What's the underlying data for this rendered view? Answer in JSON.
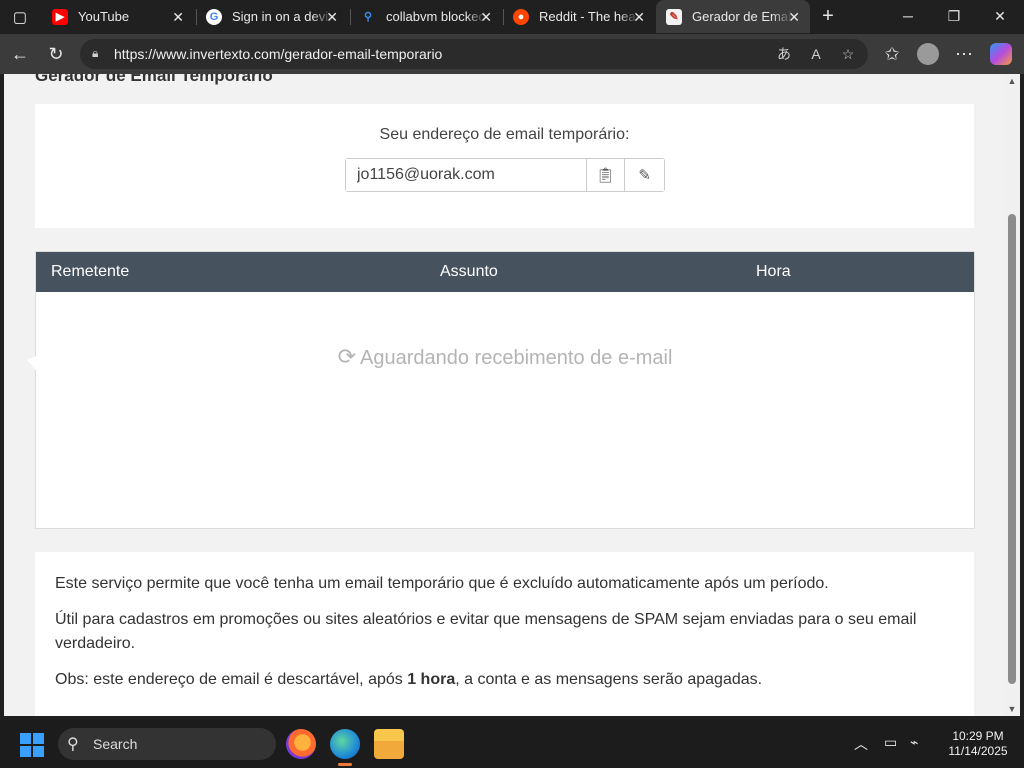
{
  "browser": {
    "tabs": [
      {
        "title": "YouTube",
        "icon": "youtube-icon",
        "color": "#ff0000"
      },
      {
        "title": "Sign in on a device",
        "icon": "google-icon",
        "color": "#4285f4"
      },
      {
        "title": "collabvm blocked",
        "icon": "bing-search-icon",
        "color": "#3b8eea"
      },
      {
        "title": "Reddit - The heart",
        "icon": "reddit-icon",
        "color": "#ff4500"
      },
      {
        "title": "Gerador de Email",
        "icon": "invertexto-icon",
        "color": "#f2f2f2"
      }
    ],
    "url": "https://www.invertexto.com/gerador-email-temporario"
  },
  "page": {
    "title": "Gerador de Email Temporário",
    "email_label": "Seu endereço de email temporário:",
    "email_value": "jo1156@uorak.com",
    "inbox": {
      "columns": [
        "Remetente",
        "Assunto",
        "Hora"
      ],
      "waiting_text": "Aguardando recebimento de e-mail"
    },
    "info": {
      "p1": "Este serviço permite que você tenha um email temporário que é excluído automaticamente após um período.",
      "p2": "Útil para cadastros em promoções ou sites aleatórios e evitar que mensagens de SPAM sejam enviadas para o seu email verdadeiro.",
      "p3_prefix": "Obs: este endereço de email é descartável, após ",
      "p3_bold": "1 hora",
      "p3_suffix": ", a conta e as mensagens serão apagadas."
    }
  },
  "taskbar": {
    "search_label": "Search",
    "time": "10:29 PM",
    "date": "11/14/2025"
  },
  "colors": {
    "table_header": "#46535e",
    "accent": "#3aa0ff"
  }
}
